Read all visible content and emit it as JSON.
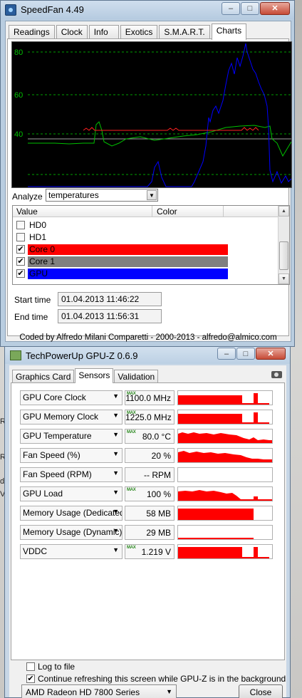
{
  "speedfan": {
    "title": "SpeedFan 4.49",
    "tabs": [
      "Readings",
      "Clock",
      "Info",
      "Exotics",
      "S.M.A.R.T.",
      "Charts"
    ],
    "active_tab": "Charts",
    "chart": {
      "y_ticks": [
        "80",
        "60",
        "40"
      ],
      "colors": {
        "core0": "#ff2020",
        "core1": "#808080",
        "gpu": "#0000ff",
        "green": "#00c000",
        "grid": "#00a000"
      }
    },
    "analyze_label": "Analyze",
    "analyze_value": "temperatures",
    "list_headers": {
      "value": "Value",
      "color": "Color"
    },
    "list_items": [
      {
        "label": "HD0",
        "checked": false,
        "color": ""
      },
      {
        "label": "HD1",
        "checked": false,
        "color": ""
      },
      {
        "label": "Core 0",
        "checked": true,
        "color": "#ff0000"
      },
      {
        "label": "Core 1",
        "checked": true,
        "color": "#808080"
      },
      {
        "label": "GPU",
        "checked": true,
        "color": "#0000ff"
      }
    ],
    "start_time_label": "Start time",
    "start_time": "01.04.2013 11:46:22",
    "end_time_label": "End time",
    "end_time": "01.04.2013 11:56:31",
    "credits": "Coded by Alfredo Milani Comparetti - 2000-2013 - alfredo@almico.com"
  },
  "gpuz": {
    "title": "TechPowerUp GPU-Z 0.6.9",
    "tabs": [
      "Graphics Card",
      "Sensors",
      "Validation"
    ],
    "active_tab": "Sensors",
    "max_tag": "MAX",
    "sensors": [
      {
        "name": "GPU Core Clock",
        "value": "1100.0 MHz",
        "max": true
      },
      {
        "name": "GPU Memory Clock",
        "value": "1225.0 MHz",
        "max": true
      },
      {
        "name": "GPU Temperature",
        "value": "80.0 °C",
        "max": true
      },
      {
        "name": "Fan Speed (%)",
        "value": "20 %",
        "max": false
      },
      {
        "name": "Fan Speed (RPM)",
        "value": "-- RPM",
        "max": false
      },
      {
        "name": "GPU Load",
        "value": "100 %",
        "max": true
      },
      {
        "name": "Memory Usage (Dedicated)",
        "value": "58 MB",
        "max": false
      },
      {
        "name": "Memory Usage (Dynamic)",
        "value": "29 MB",
        "max": false
      },
      {
        "name": "VDDC",
        "value": "1.219 V",
        "max": true
      }
    ],
    "log_to_file_label": "Log to file",
    "continue_refresh_label": "Continue refreshing this screen while GPU-Z is in the background",
    "device_select": "AMD Radeon HD 7800 Series",
    "close_label": "Close",
    "graph_color": "#ff0000"
  },
  "desktop_edge_letters": [
    "R",
    "R",
    "d",
    "V"
  ]
}
